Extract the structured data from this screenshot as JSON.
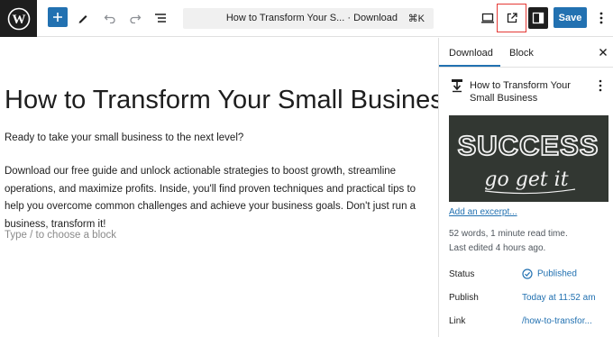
{
  "toolbar": {
    "logo_icon": "wordpress-logo",
    "add_icon": "plus-icon",
    "tools_icon": "pencil-icon",
    "undo_icon": "undo-icon",
    "redo_icon": "redo-icon",
    "outline_icon": "list-view-icon",
    "document_title": "How to Transform Your S... · Download",
    "shortcut": "⌘K",
    "preview_icon": "desktop-icon",
    "view_post_icon": "external-link-icon",
    "settings_icon": "sidebar-panel-icon",
    "save_label": "Save",
    "more_icon": "vertical-ellipsis-icon"
  },
  "editor": {
    "title": "How to Transform Your Small Business",
    "paragraph1": "Ready to take your small business to the next level?",
    "paragraph2": "Download our free guide and unlock actionable strategies to boost growth, streamline operations, and maximize profits. Inside, you'll find proven techniques and practical tips to help you overcome common challenges and achieve your business goals. Don't just run a business, transform it!",
    "block_placeholder": "Type / to choose a block"
  },
  "sidebar": {
    "tabs": [
      {
        "label": "Download",
        "active": true
      },
      {
        "label": "Block",
        "active": false
      }
    ],
    "close_icon": "close-icon",
    "post_type_icon": "download-icon",
    "post_title": "How to Transform Your Small Business",
    "featured_image": {
      "text_top": "SUCCESS",
      "text_bottom": "go get it"
    },
    "excerpt_link": "Add an excerpt...",
    "word_count": "52 words, 1 minute read time.",
    "last_edited": "Last edited 4 hours ago.",
    "rows": [
      {
        "label": "Status",
        "value": "Published",
        "icon": "published-check-icon"
      },
      {
        "label": "Publish",
        "value": "Today at 11:52 am"
      },
      {
        "label": "Link",
        "value": "/how-to-transfor..."
      }
    ]
  },
  "colors": {
    "accent": "#2271b1",
    "dark": "#1e1e1e",
    "highlight_border": "#e53935"
  }
}
